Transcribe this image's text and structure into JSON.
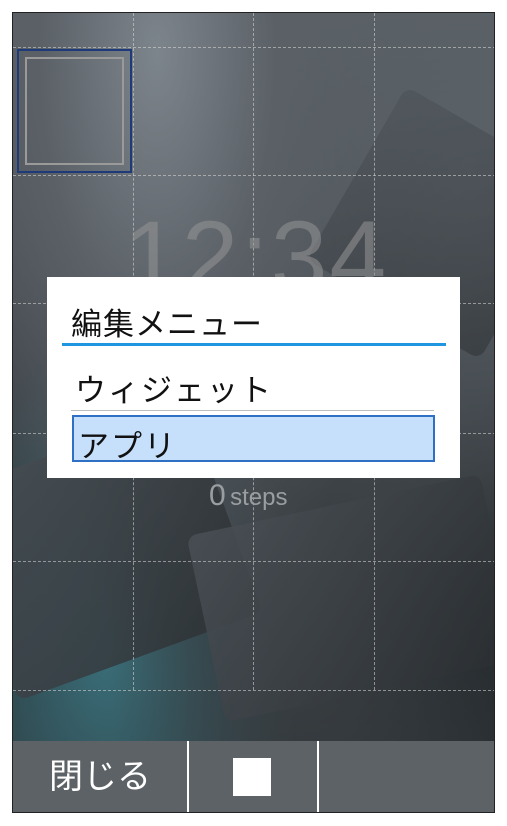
{
  "home": {
    "clock": "12:34",
    "steps_count": "0",
    "steps_unit": "steps"
  },
  "dialog": {
    "title": "編集メニュー",
    "items": [
      {
        "label": "ウィジェット",
        "selected": false
      },
      {
        "label": "アプリ",
        "selected": true
      }
    ],
    "accent_color": "#2196e0",
    "selected_bg": "#c6e0fb"
  },
  "softkeys": {
    "left_label": "閉じる",
    "center_icon": "square-icon",
    "right_label": ""
  }
}
